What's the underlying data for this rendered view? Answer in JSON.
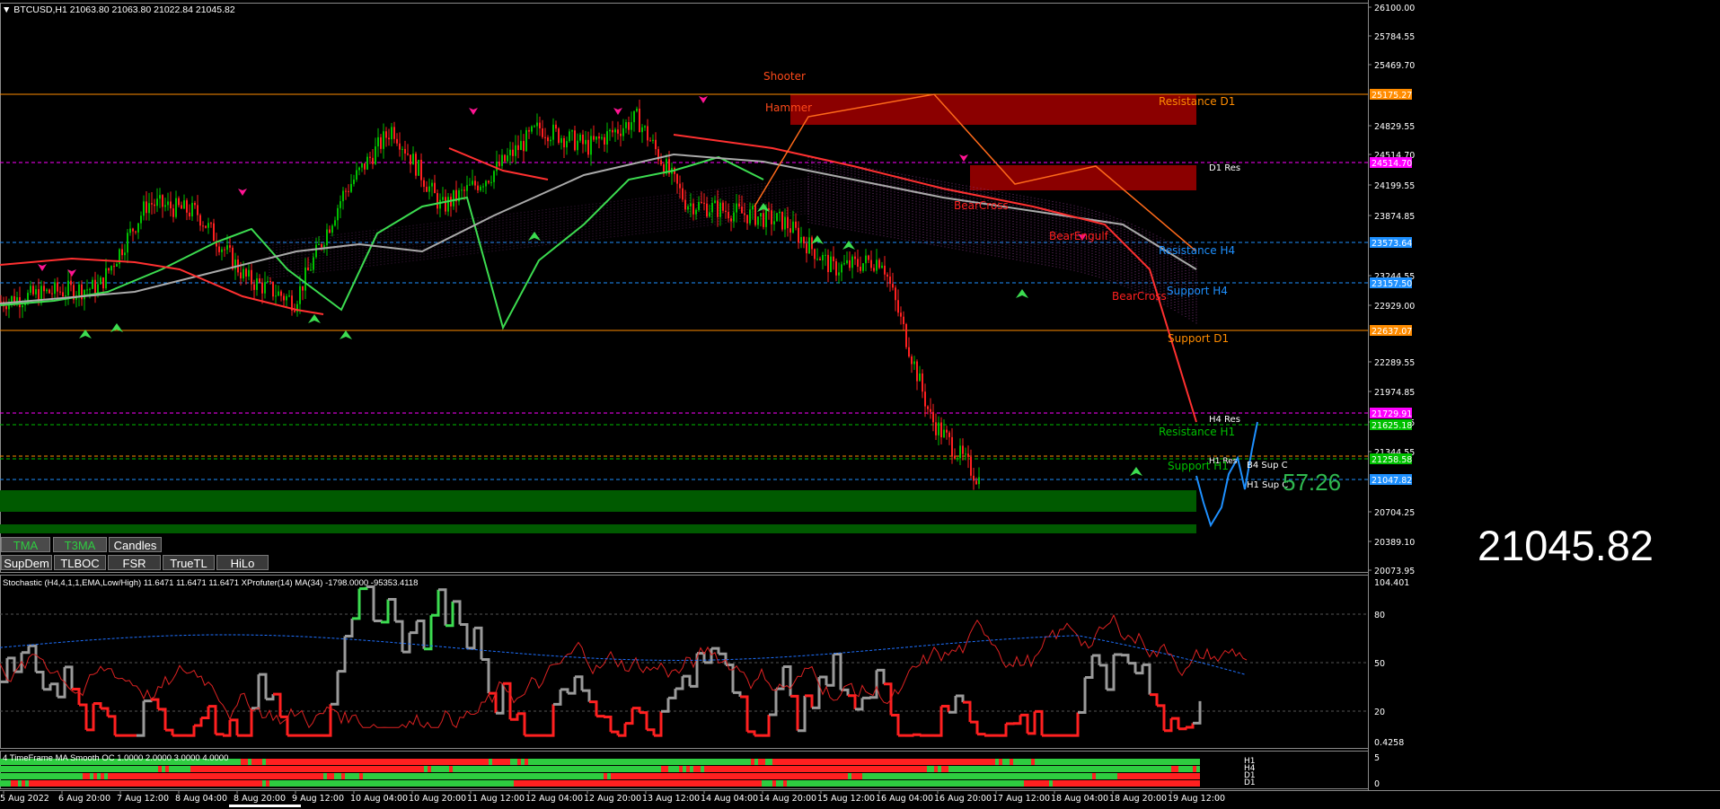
{
  "header": {
    "symbol_line": "▼ BTCUSD,H1  21063.80 21063.80 21022.84 21045.82"
  },
  "big_price": "21045.82",
  "timer": "57:26",
  "buttons_row1": [
    {
      "label": "TMA",
      "style": "tma"
    },
    {
      "label": "T3MA",
      "style": "tma"
    },
    {
      "label": "Candles",
      "style": "normal"
    }
  ],
  "buttons_row2": [
    {
      "label": "SupDem"
    },
    {
      "label": "TLBOC"
    },
    {
      "label": "FSR"
    },
    {
      "label": "TrueTL"
    },
    {
      "label": "HiLo"
    }
  ],
  "price_axis": {
    "ticks": [
      "26100.00",
      "25784.55",
      "25469.70",
      "24829.55",
      "24514.70",
      "24199.55",
      "23874.85",
      "23244.55",
      "22929.00",
      "22289.55",
      "21974.85",
      "21659.45",
      "21344.55",
      "20704.25",
      "20389.10",
      "20073.95"
    ],
    "tags": [
      {
        "value": "25175.27",
        "color": "#ff8c00"
      },
      {
        "value": "24514.70",
        "color": "#ff00ff"
      },
      {
        "value": "23573.64",
        "color": "#1e90ff"
      },
      {
        "value": "23157.50",
        "color": "#1e90ff"
      },
      {
        "value": "22637.07",
        "color": "#ff8c00"
      },
      {
        "value": "21729.91",
        "color": "#ff00ff"
      },
      {
        "value": "21625.18",
        "color": "#00c000"
      },
      {
        "value": "21258.58",
        "color": "#00c000"
      },
      {
        "value": "21047.82",
        "color": "#1e90ff"
      }
    ]
  },
  "zone_labels": {
    "resistance_d1": "Resistance D1",
    "d1_res": "D1 Res",
    "resistance_h4": "Resistance H4",
    "support_h4": "Support H4",
    "support_d1": "Support D1",
    "h4_res": "H4 Res",
    "resistance_h1": "Resistance H1",
    "h1_res": "H1 Res",
    "support_h1": "Support H1",
    "b4_sup_c": "B4 Sup C",
    "h1_sup_c": "H1 Sup C"
  },
  "pattern_labels": {
    "shooter": "Shooter",
    "hammer": "Hammer",
    "bearcross1": "BearCross",
    "bearengulf": "BearEngulf",
    "bearcross2": "BearCross"
  },
  "oscillator": {
    "header": "Stochastic (H4,4,1,1,EMA,Low/High) 11.6471 11.6471 11.6471  XProfuter(14) MA(34) -1798.0000 -95353.4118",
    "ticks": [
      "104.401",
      "80",
      "50",
      "20",
      "0.4258"
    ]
  },
  "ma_panel": {
    "header": "4 TimeFrame MA Smooth OC  1.0000 2.0000 3.0000 4.0000",
    "ticks": [
      "5",
      "0"
    ],
    "tf_labels": [
      "H1",
      "H4",
      "D1",
      "D1"
    ]
  },
  "time_axis": [
    "5 Aug 2022",
    "6 Aug 20:00",
    "7 Aug 12:00",
    "8 Aug 04:00",
    "8 Aug 20:00",
    "9 Aug 12:00",
    "10 Aug 04:00",
    "10 Aug 20:00",
    "11 Aug 12:00",
    "12 Aug 04:00",
    "12 Aug 20:00",
    "13 Aug 12:00",
    "14 Aug 04:00",
    "14 Aug 20:00",
    "15 Aug 12:00",
    "16 Aug 04:00",
    "16 Aug 20:00",
    "17 Aug 12:00",
    "18 Aug 04:00",
    "18 Aug 20:00",
    "19 Aug 12:00"
  ],
  "chart_data": {
    "type": "candlestick",
    "symbol": "BTCUSD",
    "timeframe": "H1",
    "ylim": [
      20073.95,
      26100.0
    ],
    "last_price": 21045.82,
    "approx_close_path": [
      {
        "t": "5 Aug 2022",
        "price": 22950
      },
      {
        "t": "6 Aug 20:00",
        "price": 23050
      },
      {
        "t": "7 Aug 12:00",
        "price": 23100
      },
      {
        "t": "8 Aug 04:00",
        "price": 24000
      },
      {
        "t": "8 Aug 20:00",
        "price": 23900
      },
      {
        "t": "9 Aug 12:00",
        "price": 23200
      },
      {
        "t": "10 Aug 04:00",
        "price": 22950
      },
      {
        "t": "10 Aug 20:00",
        "price": 24100
      },
      {
        "t": "11 Aug 12:00",
        "price": 24800
      },
      {
        "t": "12 Aug 04:00",
        "price": 23950
      },
      {
        "t": "12 Aug 20:00",
        "price": 24300
      },
      {
        "t": "13 Aug 12:00",
        "price": 24800
      },
      {
        "t": "14 Aug 04:00",
        "price": 24600
      },
      {
        "t": "14 Aug 20:00",
        "price": 24900
      },
      {
        "t": "15 Aug 12:00",
        "price": 24000
      },
      {
        "t": "16 Aug 04:00",
        "price": 23900
      },
      {
        "t": "16 Aug 20:00",
        "price": 23800
      },
      {
        "t": "17 Aug 12:00",
        "price": 23300
      },
      {
        "t": "18 Aug 04:00",
        "price": 23400
      },
      {
        "t": "18 Aug 20:00",
        "price": 21700
      },
      {
        "t": "19 Aug 12:00",
        "price": 21045.82
      }
    ]
  },
  "colors": {
    "bull": "#00c000",
    "bear": "#ff2020",
    "resistance_zone": "#8b0000",
    "support_zone": "#005a00",
    "orange": "#ff8c00",
    "blue": "#1e90ff"
  }
}
